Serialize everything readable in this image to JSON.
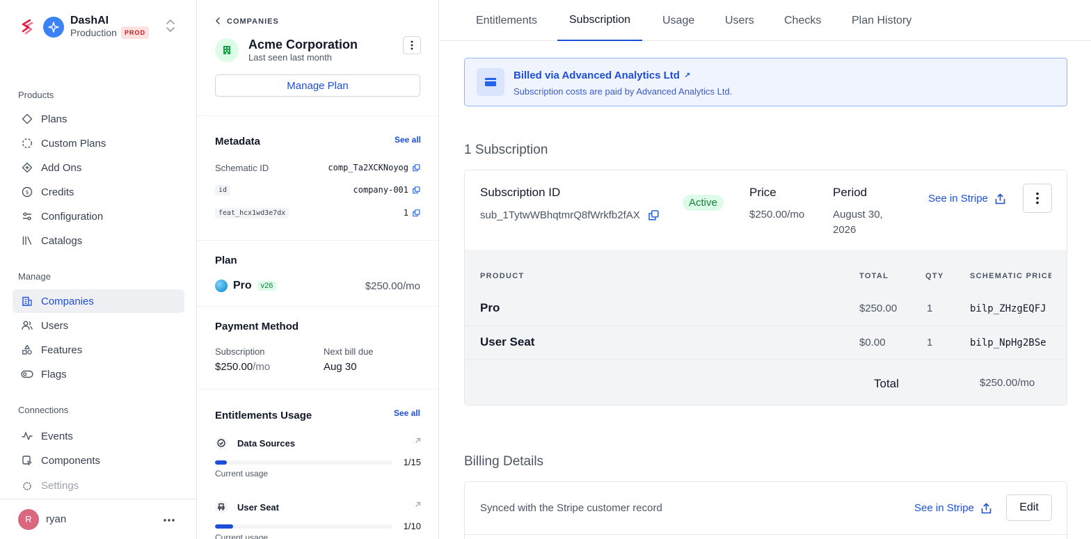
{
  "brand": {
    "name": "DashAI",
    "environment": "Production",
    "env_badge": "PROD"
  },
  "sidebar": {
    "sections": [
      {
        "heading": "Products",
        "items": [
          {
            "label": "Plans",
            "icon": "diamond-icon"
          },
          {
            "label": "Custom Plans",
            "icon": "dashed-circle-icon"
          },
          {
            "label": "Add Ons",
            "icon": "diamond-plus-icon"
          },
          {
            "label": "Credits",
            "icon": "coin-icon"
          },
          {
            "label": "Configuration",
            "icon": "sliders-icon"
          },
          {
            "label": "Catalogs",
            "icon": "library-icon"
          }
        ]
      },
      {
        "heading": "Manage",
        "items": [
          {
            "label": "Companies",
            "icon": "building-icon",
            "active": true
          },
          {
            "label": "Users",
            "icon": "users-icon"
          },
          {
            "label": "Features",
            "icon": "shapes-icon"
          },
          {
            "label": "Flags",
            "icon": "toggle-icon"
          }
        ]
      },
      {
        "heading": "Connections",
        "items": [
          {
            "label": "Events",
            "icon": "activity-icon"
          },
          {
            "label": "Components",
            "icon": "component-icon"
          },
          {
            "label": "Settings",
            "icon": "gear-icon"
          }
        ]
      }
    ],
    "user": {
      "initial": "R",
      "name": "ryan"
    }
  },
  "company": {
    "breadcrumb": "COMPANIES",
    "name": "Acme Corporation",
    "last_seen": "Last seen last month",
    "manage_plan_label": "Manage Plan"
  },
  "metadata": {
    "title": "Metadata",
    "see_all": "See all",
    "rows": [
      {
        "key": "Schematic ID",
        "value": "comp_Ta2XCKNoyog"
      },
      {
        "key": "id",
        "value": "company-001"
      },
      {
        "key": "feat_hcx1wd3e7dx",
        "value": "1"
      }
    ]
  },
  "plan": {
    "title": "Plan",
    "name": "Pro",
    "version": "v26",
    "price": "$250.00/mo"
  },
  "payment": {
    "title": "Payment Method",
    "subscription_label": "Subscription",
    "subscription_amount": "$250.00",
    "subscription_unit": "/mo",
    "next_bill_label": "Next bill due",
    "next_bill_value": "Aug 30"
  },
  "entitlements": {
    "title": "Entitlements Usage",
    "see_all": "See all",
    "items": [
      {
        "name": "Data Sources",
        "count": "1/15",
        "usage_fraction": 0.0667,
        "sub": "Current usage"
      },
      {
        "name": "User Seat",
        "count": "1/10",
        "usage_fraction": 0.1,
        "sub": "Current usage"
      }
    ]
  },
  "tabs": [
    "Entitlements",
    "Subscription",
    "Usage",
    "Users",
    "Checks",
    "Plan History"
  ],
  "active_tab": "Subscription",
  "billed": {
    "title": "Billed via Advanced Analytics Ltd",
    "ext_icon": "↗",
    "description": "Subscription costs are paid by Advanced Analytics Ltd."
  },
  "subscription": {
    "heading": "1 Subscription",
    "id_label": "Subscription ID",
    "id_value": "sub_1TytwWBhqtmrQ8fWrkfb2fAX",
    "status": "Active",
    "price_label": "Price",
    "price_value": "$250.00/mo",
    "period_label": "Period",
    "period_value": "August 30, 2026",
    "stripe_link": "See in Stripe",
    "columns": [
      "PRODUCT",
      "TOTAL",
      "QTY",
      "SCHEMATIC PRICE"
    ],
    "rows": [
      {
        "product": "Pro",
        "total": "$250.00",
        "qty": "1",
        "price_id": "bilp_ZHzgEQFJ"
      },
      {
        "product": "User Seat",
        "total": "$0.00",
        "qty": "1",
        "price_id": "bilp_NpHg2BSe"
      }
    ],
    "total_label": "Total",
    "total_value": "$250.00/mo"
  },
  "billing": {
    "heading": "Billing Details",
    "synced_text": "Synced with the Stripe customer record",
    "stripe_link": "See in Stripe",
    "edit_label": "Edit"
  },
  "colors": {
    "accent": "#1d4ed8",
    "success": "#15803d",
    "danger": "#b91c1c"
  }
}
